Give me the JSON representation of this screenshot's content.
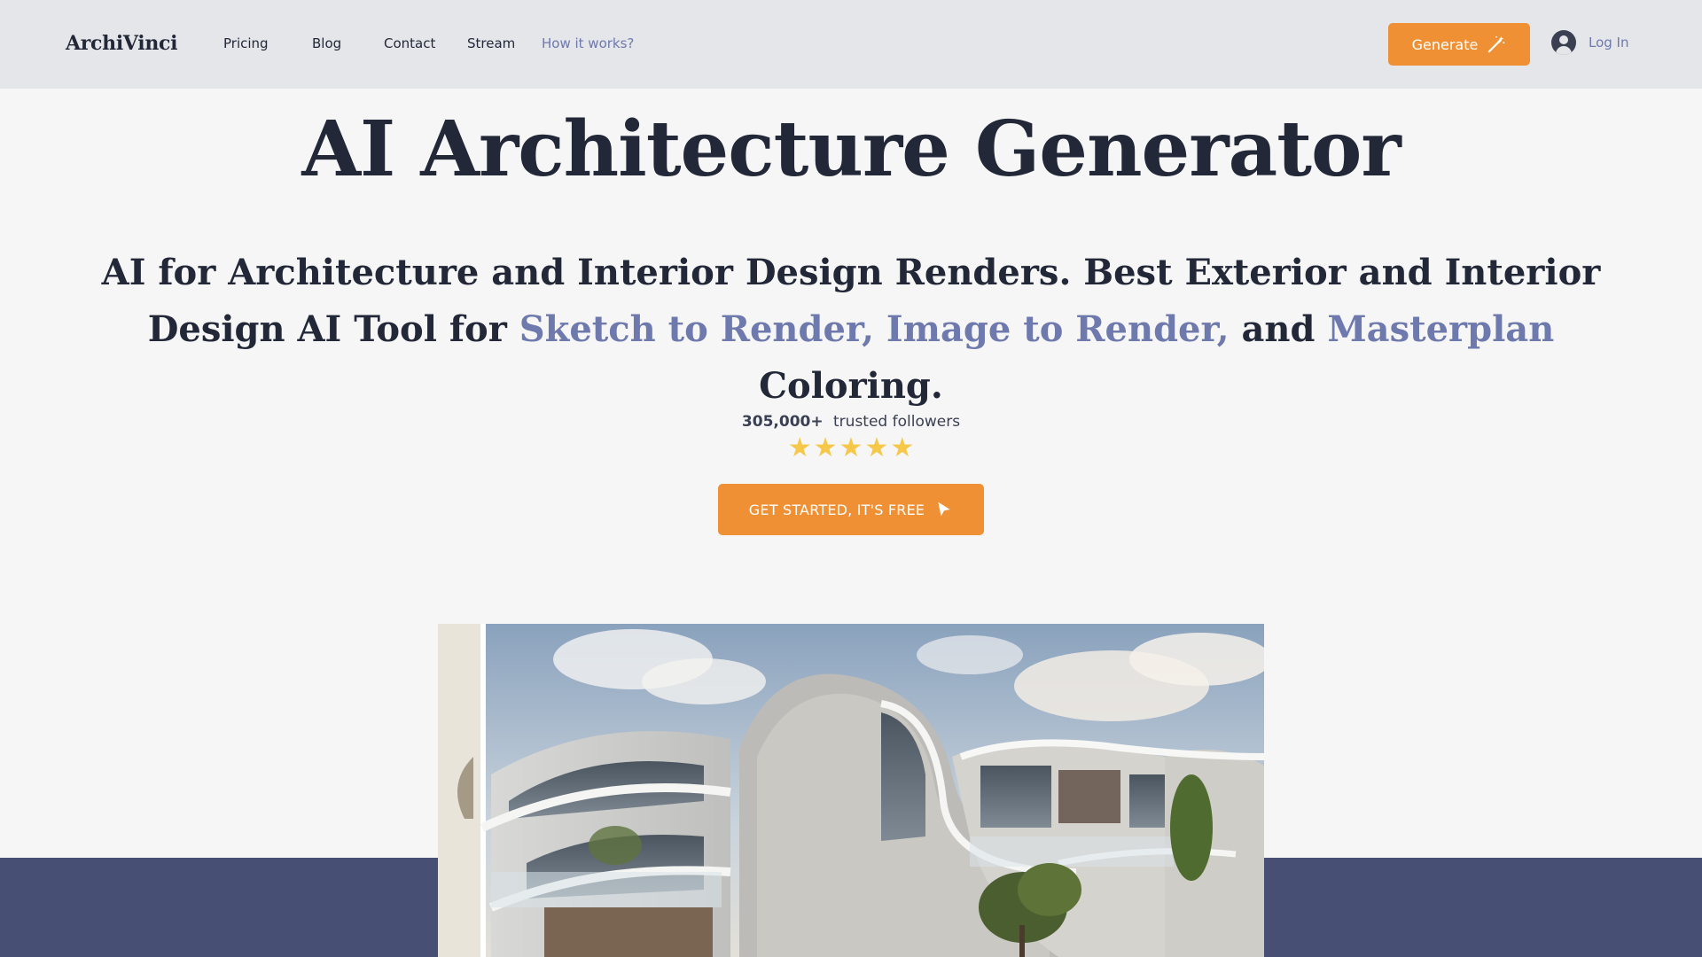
{
  "header": {
    "logo": "ArchiVinci",
    "nav": [
      {
        "label": "Pricing"
      },
      {
        "label": "Blog"
      },
      {
        "label": "Contact"
      },
      {
        "label": "Stream"
      },
      {
        "label": "How it works?"
      }
    ],
    "generate_label": "Generate",
    "login_label": "Log In"
  },
  "hero": {
    "title": "AI Architecture Generator",
    "subtitle_part1": "AI for Architecture and Interior Design Renders. Best Exterior and Interior Design AI Tool for ",
    "subtitle_highlight1": "Sketch to Render, Image to Render,",
    "subtitle_part2": " and ",
    "subtitle_highlight2": "Masterplan",
    "subtitle_part3": " Coloring.",
    "followers_count": "305,000+",
    "followers_label": "trusted followers",
    "rating_stars": 5,
    "cta_label": "GET STARTED, IT'S FREE"
  },
  "colors": {
    "accent_orange": "#ef9034",
    "accent_blue": "#6e79ad",
    "navy_band": "#474f74",
    "text_dark": "#222838",
    "star_yellow": "#f6c84a"
  },
  "icons": {
    "generate": "magic-wand-icon",
    "login": "user-avatar-icon",
    "cta": "cursor-arrow-icon",
    "rating": "star-icon"
  }
}
